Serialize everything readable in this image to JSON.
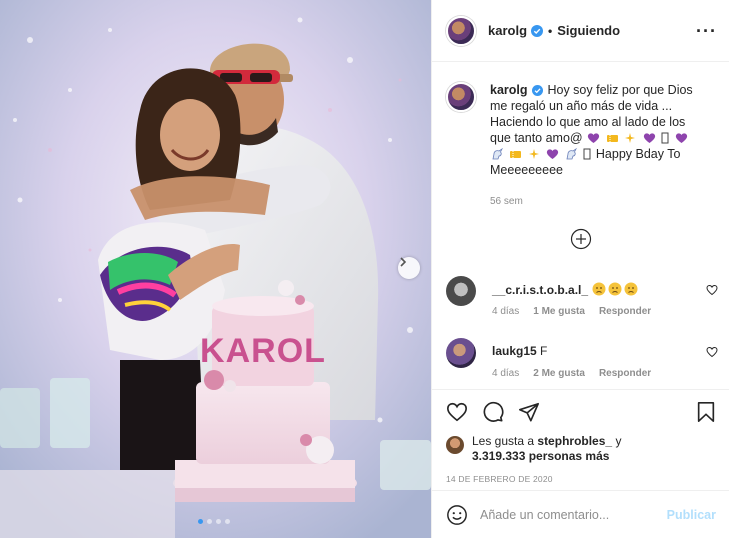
{
  "header": {
    "username": "karolg",
    "separator": "•",
    "follow_status": "Siguiendo",
    "more_label": "..."
  },
  "caption": {
    "username": "karolg",
    "text_1": "Hoy soy feliz por que Dios me regaló un año más de vida ... Haciendo lo que amo al lado de los que tanto amo@",
    "text_2": "Happy Bday To Meeeeeeeee",
    "time": "56 sem"
  },
  "comments": [
    {
      "username": "__c.r.i.s.t.o.b.a.l_",
      "text": "",
      "time": "4 días",
      "likes": "1 Me gusta",
      "reply": "Responder"
    },
    {
      "username": "laukg15",
      "text": "F",
      "time": "4 días",
      "likes": "2 Me gusta",
      "reply": "Responder"
    }
  ],
  "likes": {
    "prefix": "Les gusta a",
    "user": "stephrobles_",
    "connector": "y",
    "count": "3.319.333 personas más"
  },
  "date": "14 DE FEBRERO DE 2020",
  "compose": {
    "placeholder": "Añade un comentario...",
    "publish": "Publicar"
  },
  "photo": {
    "cake_text": "KAROL",
    "carousel_total": 4,
    "carousel_active": 0
  },
  "colors": {
    "verified": "#3897f0",
    "publish_disabled": "#b2dffc",
    "muted": "#8e8e8e",
    "purple_heart": "#8e44ad"
  }
}
